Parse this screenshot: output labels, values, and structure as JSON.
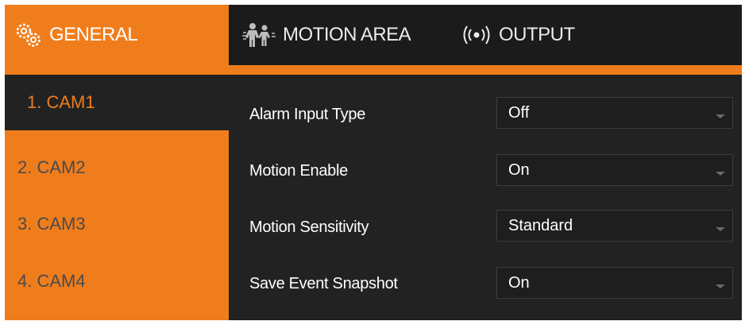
{
  "tabs": [
    {
      "label": "GENERAL",
      "icon": "gears-icon",
      "active": true
    },
    {
      "label": "MOTION AREA",
      "icon": "motion-people-icon",
      "active": false
    },
    {
      "label": "OUTPUT",
      "icon": "broadcast-icon",
      "active": false
    }
  ],
  "cameras": [
    {
      "label": "1. CAM1",
      "active": true
    },
    {
      "label": "2. CAM2",
      "active": false
    },
    {
      "label": "3. CAM3",
      "active": false
    },
    {
      "label": "4. CAM4",
      "active": false
    }
  ],
  "settings": [
    {
      "label": "Alarm Input Type",
      "value": "Off"
    },
    {
      "label": "Motion Enable",
      "value": "On"
    },
    {
      "label": "Motion Sensitivity",
      "value": "Standard"
    },
    {
      "label": "Save Event Snapshot",
      "value": "On"
    }
  ],
  "colors": {
    "accent": "#f07d1c",
    "panel": "#222222",
    "tabbar": "#1b1b1b",
    "inactive_cam_text": "#4b4b4b"
  }
}
